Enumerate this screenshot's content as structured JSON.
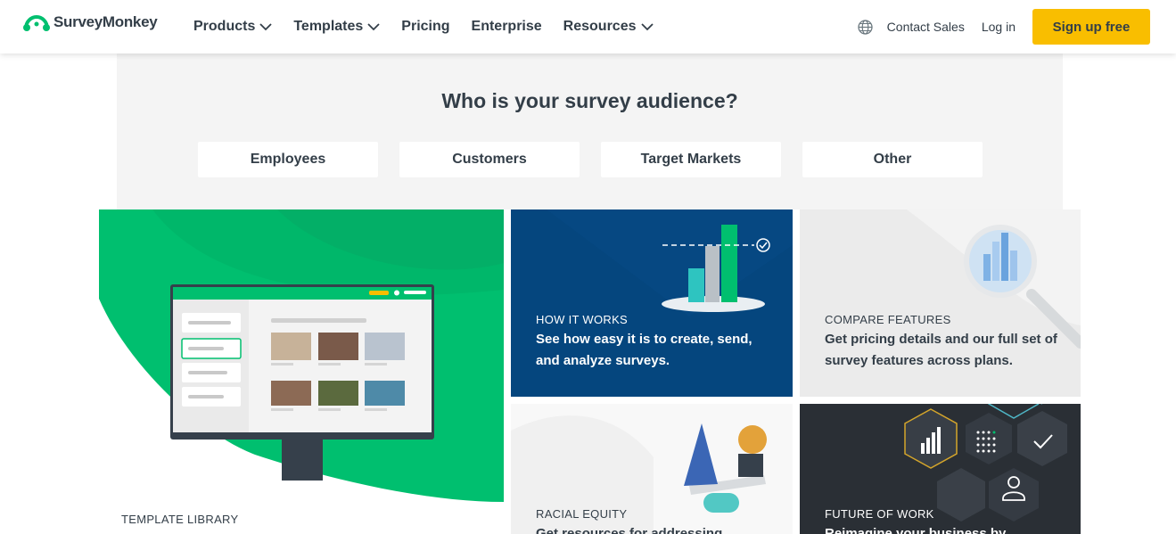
{
  "header": {
    "logo_text": "SurveyMonkey",
    "nav": [
      {
        "label": "Products"
      },
      {
        "label": "Templates"
      },
      {
        "label": "Pricing"
      },
      {
        "label": "Enterprise"
      },
      {
        "label": "Resources"
      }
    ],
    "globe_icon": "globe-icon",
    "contact_sales": "Contact Sales",
    "login": "Log in",
    "signup": "Sign up free"
  },
  "audience": {
    "title": "Who is your survey audience?",
    "options": [
      "Employees",
      "Customers",
      "Target Markets",
      "Other"
    ]
  },
  "cards": {
    "template_library": {
      "eyebrow": "TEMPLATE LIBRARY"
    },
    "how_it_works": {
      "eyebrow": "HOW IT WORKS",
      "text": "See how easy it is to create, send, and analyze surveys."
    },
    "compare_features": {
      "eyebrow": "COMPARE FEATURES",
      "text": "Get pricing details and our full set of survey features across plans."
    },
    "racial_equity": {
      "eyebrow": "RACIAL EQUITY",
      "text": "Get resources for addressing"
    },
    "future_of_work": {
      "eyebrow": "FUTURE OF WORK",
      "text": "Reimagine your business by"
    }
  },
  "colors": {
    "brand_green": "#00bf6f",
    "cta_yellow": "#f9be00",
    "navy": "#05467e",
    "text_dark": "#333e48"
  }
}
